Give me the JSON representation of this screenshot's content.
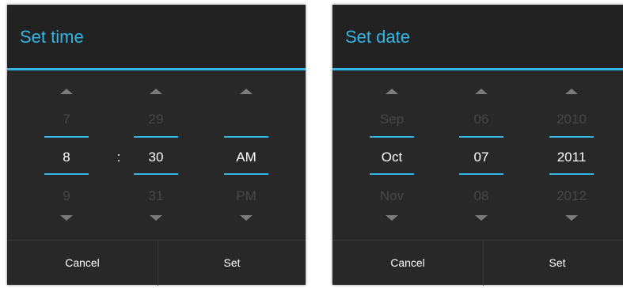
{
  "time_dialog": {
    "title": "Set time",
    "hour": {
      "prev": "7",
      "value": "8",
      "next": "9"
    },
    "separator": ":",
    "minute": {
      "prev": "29",
      "value": "30",
      "next": "31"
    },
    "ampm": {
      "prev": "",
      "value": "AM",
      "next": "PM"
    },
    "cancel_label": "Cancel",
    "set_label": "Set"
  },
  "date_dialog": {
    "title": "Set date",
    "month": {
      "prev": "Sep",
      "value": "Oct",
      "next": "Nov"
    },
    "day": {
      "prev": "06",
      "value": "07",
      "next": "08"
    },
    "year": {
      "prev": "2010",
      "value": "2011",
      "next": "2012"
    },
    "cancel_label": "Cancel",
    "set_label": "Set"
  },
  "colors": {
    "accent": "#33b5e5",
    "dialog_bg": "#282828",
    "title_bg": "#222222",
    "dim_text": "#484848",
    "arrow": "#7b7b7b"
  },
  "icons": [
    "chevron-up-icon",
    "chevron-down-icon"
  ]
}
